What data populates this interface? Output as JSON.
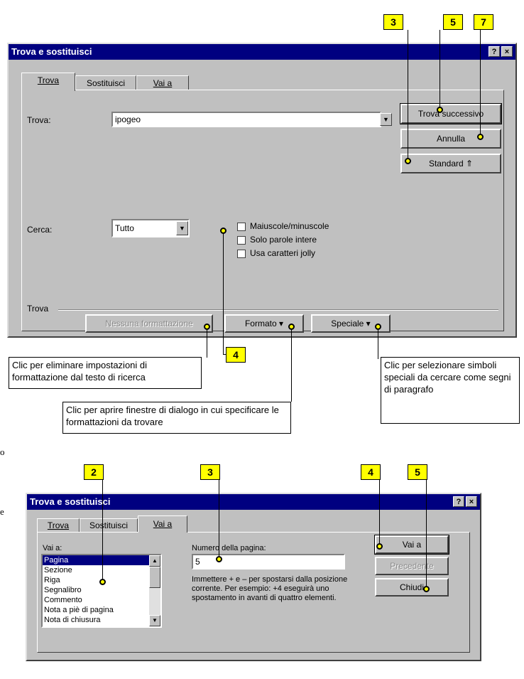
{
  "dialog1": {
    "title": "Trova e sostituisci",
    "help": "?",
    "close": "×",
    "tabs": [
      "Trova",
      "Sostituisci",
      "Vai a"
    ],
    "find_label": "Trova:",
    "find_value": "ipogeo",
    "buttons": {
      "find_next": "Trova successivo",
      "cancel": "Annulla",
      "standard": "Standard ⇑"
    },
    "search_label": "Cerca:",
    "search_value": "Tutto",
    "checks": [
      "Maiuscole/minuscole",
      "Solo parole intere",
      "Usa caratteri jolly"
    ],
    "group_label": "Trova",
    "bottom_buttons": {
      "no_format": "Nessuna formattazione",
      "format": "Formato ▾",
      "special": "Speciale ▾"
    }
  },
  "dialog2": {
    "title": "Trova e sostituisci",
    "help": "?",
    "close": "×",
    "tabs": [
      "Trova",
      "Sostituisci",
      "Vai a"
    ],
    "goto_label": "Vai a:",
    "list_items": [
      "Pagina",
      "Sezione",
      "Riga",
      "Segnalibro",
      "Commento",
      "Nota a piè di pagina",
      "Nota di chiusura"
    ],
    "page_number_label": "Numero della pagina:",
    "page_number_value": "5",
    "help_text": "Immettere + e – per spostarsi dalla posizione corrente. Per esempio: +4 eseguirà uno spostamento in avanti di quattro elementi.",
    "buttons": {
      "goto": "Vai a",
      "previous": "Precedente",
      "close": "Chiudi"
    }
  },
  "badges": {
    "d1_3": "3",
    "d1_5": "5",
    "d1_7": "7",
    "d1_4": "4",
    "d2_2": "2",
    "d2_3": "3",
    "d2_4": "4",
    "d2_5": "5"
  },
  "callouts": {
    "no_format": "Clic per eliminare impostazioni di formattazione dal testo di ricerca",
    "special": "Clic per selezionare simboli speciali da cercare come segni di paragrafo",
    "format": "Clic per aprire finestre di dialogo in cui specificare le formattazioni da trovare"
  },
  "margin_fragments": [
    "o",
    "e"
  ]
}
